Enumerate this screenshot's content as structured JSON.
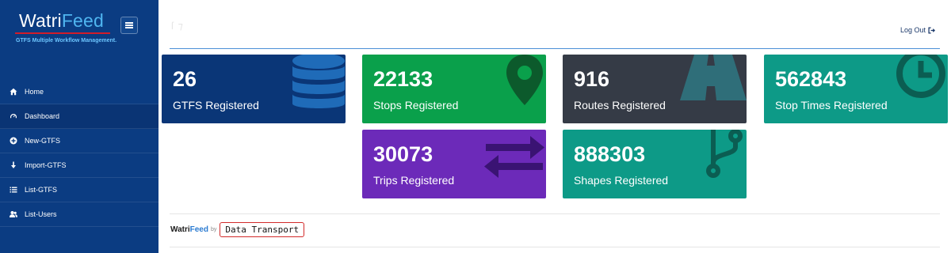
{
  "brand": {
    "name_part1": "Watri",
    "name_part2": "Feed",
    "tagline": "GTFS Multiple Workflow Management.",
    "accent_color": "#4fb5f0",
    "underline_color": "#d11d2a"
  },
  "sidebar": {
    "bg_color": "#0b3c82",
    "items": [
      {
        "label": "Home",
        "icon": "home-icon"
      },
      {
        "label": "Dashboard",
        "icon": "gauge-icon",
        "active": true
      },
      {
        "label": "New-GTFS",
        "icon": "plus-circle-icon"
      },
      {
        "label": "Import-GTFS",
        "icon": "download-icon"
      },
      {
        "label": "List-GTFS",
        "icon": "list-icon"
      },
      {
        "label": "List-Users",
        "icon": "users-icon"
      }
    ]
  },
  "header": {
    "logout_label": "Log Out",
    "logout_icon": "logout-icon"
  },
  "cards": [
    {
      "value": "26",
      "label": "GTFS Registered",
      "color": "#0a3677",
      "icon": "database-icon"
    },
    {
      "value": "22133",
      "label": "Stops Registered",
      "color": "#0aa04b",
      "icon": "map-marker-icon"
    },
    {
      "value": "916",
      "label": "Routes Registered",
      "color": "#353b46",
      "icon": "road-icon"
    },
    {
      "value": "562843",
      "label": "Stop Times Registered",
      "color": "#0d9a87",
      "icon": "clock-icon"
    },
    {
      "value": "30073",
      "label": "Trips Registered",
      "color": "#6c2ab9",
      "icon": "exchange-icon"
    },
    {
      "value": "888303",
      "label": "Shapes Registered",
      "color": "#0d9a87",
      "icon": "branch-icon"
    }
  ],
  "footer": {
    "brand_part1": "Watri",
    "brand_part2": "Feed",
    "by": "by",
    "partner": "Data Transport"
  }
}
